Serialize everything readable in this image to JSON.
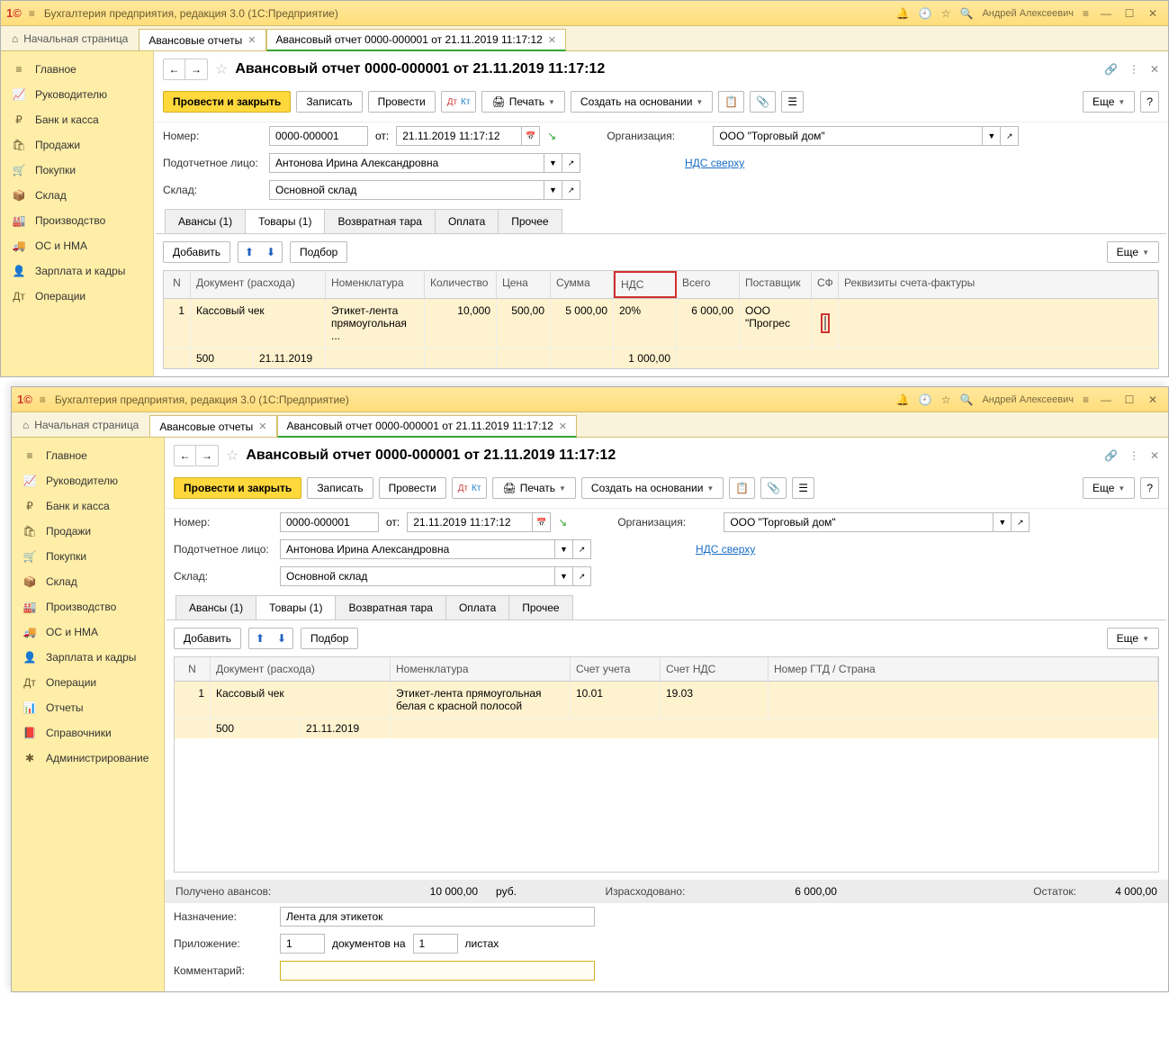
{
  "titlebar": {
    "app_title": "Бухгалтерия предприятия, редакция 3.0  (1С:Предприятие)",
    "username": "Андрей Алексеевич"
  },
  "tabs": {
    "home": "Начальная страница",
    "list": "Авансовые отчеты",
    "doc": "Авансовый отчет 0000-000001 от 21.11.2019 11:17:12"
  },
  "sidebar": [
    {
      "icon": "≡",
      "label": "Главное"
    },
    {
      "icon": "📈",
      "label": "Руководителю"
    },
    {
      "icon": "₽",
      "label": "Банк и касса"
    },
    {
      "icon": "🛍",
      "label": "Продажи"
    },
    {
      "icon": "🛒",
      "label": "Покупки"
    },
    {
      "icon": "📦",
      "label": "Склад"
    },
    {
      "icon": "🏭",
      "label": "Производство"
    },
    {
      "icon": "🚚",
      "label": "ОС и НМА"
    },
    {
      "icon": "👤",
      "label": "Зарплата и кадры"
    },
    {
      "icon": "Дт",
      "label": "Операции"
    },
    {
      "icon": "📊",
      "label": "Отчеты"
    },
    {
      "icon": "📕",
      "label": "Справочники"
    },
    {
      "icon": "✱",
      "label": "Администрирование"
    }
  ],
  "doc": {
    "title": "Авансовый отчет 0000-000001 от 21.11.2019 11:17:12",
    "buttons": {
      "post_close": "Провести и закрыть",
      "write": "Записать",
      "post": "Провести",
      "print": "Печать",
      "create_based": "Создать на основании",
      "more": "Еще"
    },
    "labels": {
      "number": "Номер:",
      "from": "от:",
      "org": "Организация:",
      "person": "Подотчетное лицо:",
      "warehouse": "Склад:",
      "vat_link": "НДС сверху",
      "purpose": "Назначение:",
      "attachments": "Приложение:",
      "docs_on": "документов на",
      "sheets": "листах",
      "comment": "Комментарий:"
    },
    "values": {
      "number": "0000-000001",
      "date": "21.11.2019 11:17:12",
      "org": "ООО \"Торговый дом\"",
      "person": "Антонова Ирина Александровна",
      "warehouse": "Основной склад",
      "purpose": "Лента для этикеток",
      "att_docs": "1",
      "att_sheets": "1"
    },
    "subtabs": {
      "advances": "Авансы (1)",
      "goods": "Товары (1)",
      "tare": "Возвратная тара",
      "payment": "Оплата",
      "other": "Прочее"
    },
    "tbl_buttons": {
      "add": "Добавить",
      "select": "Подбор",
      "more": "Еще"
    }
  },
  "table_a": {
    "cols": {
      "n": "N",
      "doc": "Документ (расхода)",
      "nomen": "Номенклатура",
      "qty": "Количество",
      "price": "Цена",
      "sum": "Сумма",
      "vat": "НДС",
      "total": "Всего",
      "supplier": "Поставщик",
      "sf": "СФ",
      "sf_req": "Реквизиты счета-фактуры"
    },
    "row": {
      "n": "1",
      "doc": "Кассовый чек",
      "doc_num": "500",
      "doc_date": "21.11.2019",
      "nomen": "Этикет-лента прямоугольная ...",
      "qty": "10,000",
      "price": "500,00",
      "sum": "5 000,00",
      "vat": "20%",
      "vat_sum": "1 000,00",
      "total": "6 000,00",
      "supplier": "ООО \"Прогрес"
    }
  },
  "table_b": {
    "cols": {
      "n": "N",
      "doc": "Документ (расхода)",
      "nomen": "Номенклатура",
      "acct": "Счет учета",
      "vat_acct": "Счет НДС",
      "gtd": "Номер ГТД / Страна"
    },
    "row": {
      "n": "1",
      "doc": "Кассовый чек",
      "doc_num": "500",
      "doc_date": "21.11.2019",
      "nomen": "Этикет-лента прямоугольная белая с красной полосой",
      "acct": "10.01",
      "vat_acct": "19.03"
    }
  },
  "footer": {
    "received_label": "Получено авансов:",
    "received_val": "10 000,00",
    "received_cur": "руб.",
    "spent_label": "Израсходовано:",
    "spent_val": "6 000,00",
    "balance_label": "Остаток:",
    "balance_val": "4 000,00"
  }
}
